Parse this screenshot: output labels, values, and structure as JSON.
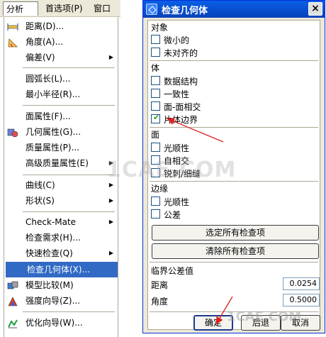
{
  "menubar": {
    "analysis": "分析(L)",
    "preferences": "首选项(P)",
    "window": "窗口"
  },
  "menu": {
    "items": [
      {
        "label": "距离(D)...",
        "icon": "distance-icon",
        "arrow": false
      },
      {
        "label": "角度(A)...",
        "icon": "angle-icon",
        "arrow": false
      },
      {
        "label": "偏差(V)",
        "icon": "",
        "arrow": true
      },
      {
        "label": "圆弧长(L)...",
        "icon": "",
        "arrow": false
      },
      {
        "label": "最小半径(R)...",
        "icon": "",
        "arrow": false
      },
      {
        "label": "面属性(F)...",
        "icon": "",
        "arrow": false
      },
      {
        "label": "几何属性(G)...",
        "icon": "geometry-props-icon",
        "arrow": false
      },
      {
        "label": "质量属性(P)...",
        "icon": "",
        "arrow": false
      },
      {
        "label": "高级质量属性(E)",
        "icon": "",
        "arrow": true
      },
      {
        "label": "曲线(C)",
        "icon": "",
        "arrow": true
      },
      {
        "label": "形状(S)",
        "icon": "",
        "arrow": true
      },
      {
        "label": "Check-Mate",
        "icon": "",
        "arrow": true
      },
      {
        "label": "检查需求(H)...",
        "icon": "",
        "arrow": false
      },
      {
        "label": "快速检查(Q)",
        "icon": "",
        "arrow": true
      },
      {
        "label": "检查几何体(X)...",
        "icon": "",
        "arrow": false
      },
      {
        "label": "模型比较(M)",
        "icon": "model-compare-icon",
        "arrow": false
      },
      {
        "label": "强度向导(Z)...",
        "icon": "strength-wizard-icon",
        "arrow": false
      },
      {
        "label": "优化向导(W)...",
        "icon": "optimize-wizard-icon",
        "arrow": false
      }
    ]
  },
  "dialog": {
    "title": "检查几何体",
    "close": "×",
    "sections": {
      "objects": {
        "title": "对象",
        "items": [
          {
            "label": "微小的",
            "checked": false
          },
          {
            "label": "未对齐的",
            "checked": false
          }
        ]
      },
      "body": {
        "title": "体",
        "items": [
          {
            "label": "数据结构",
            "checked": false
          },
          {
            "label": "一致性",
            "checked": false
          },
          {
            "label": "面-面相交",
            "checked": false
          },
          {
            "label": "片体边界",
            "checked": true
          }
        ]
      },
      "face": {
        "title": "面",
        "items": [
          {
            "label": "光顺性",
            "checked": false
          },
          {
            "label": "自相交",
            "checked": false
          },
          {
            "label": "锐刺/细缝",
            "checked": false
          }
        ]
      },
      "edge": {
        "title": "边缘",
        "items": [
          {
            "label": "光顺性",
            "checked": false
          },
          {
            "label": "公差",
            "checked": false
          }
        ]
      }
    },
    "select_all": "选定所有检查项",
    "clear_all": "清除所有检查项",
    "tolerance_title": "临界公差值",
    "distance_label": "距离",
    "distance_value": "0.0254",
    "angle_label": "角度",
    "angle_value": "0.5000",
    "ok": "确定",
    "back": "后退",
    "cancel": "取消"
  },
  "watermark": "1CAE.COM",
  "watermark2": "1CAE.COM"
}
